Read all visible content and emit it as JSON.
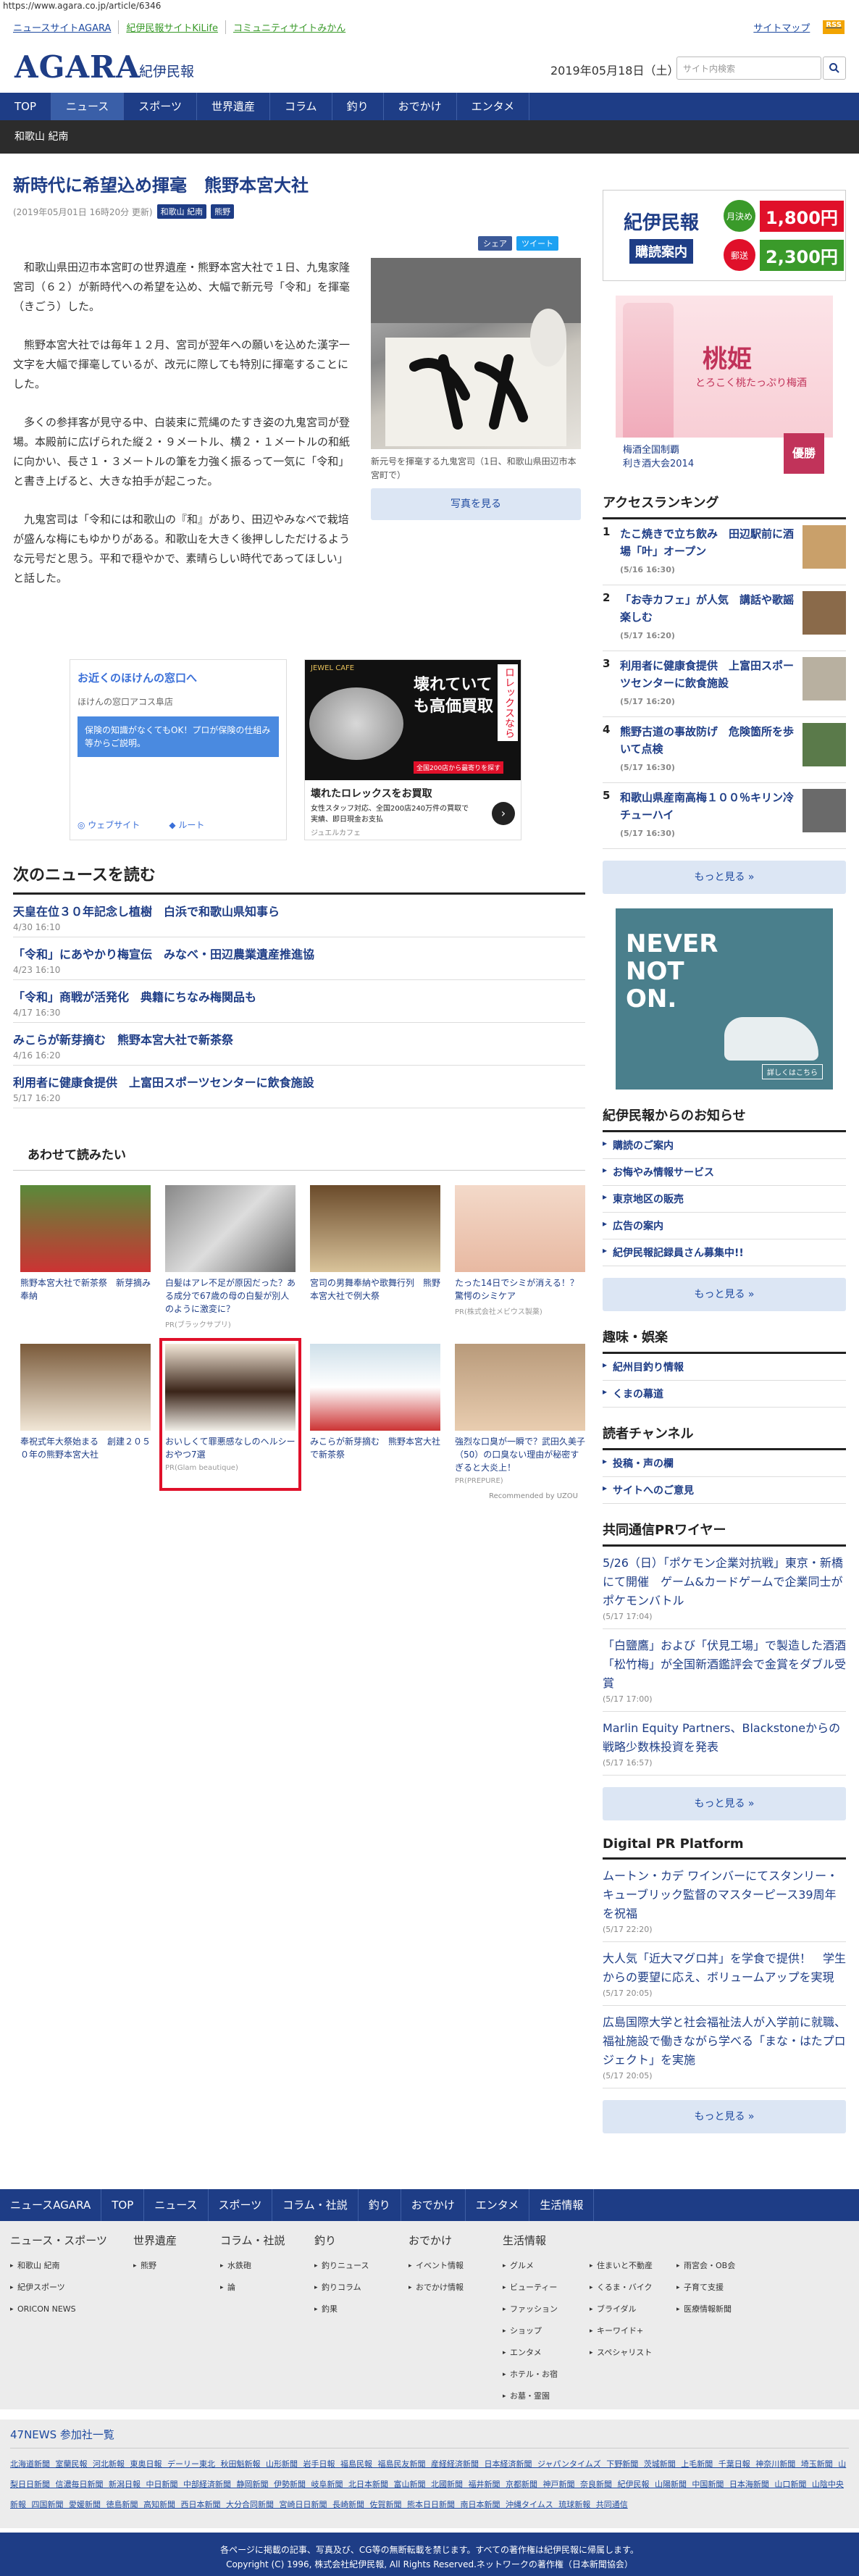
{
  "browser": {
    "url": "https://www.agara.co.jp/article/6346"
  },
  "header": {
    "links": [
      "ニュースサイトAGARA",
      "紀伊民報サイトKiLife",
      "コミュニティサイトみかん"
    ],
    "right_links": [
      "サイトマップ",
      "RSS"
    ],
    "logo": "AGARA",
    "logo_sub": "紀伊民報",
    "date": "2019年05月18日（土）",
    "search_placeholder": "サイト内検索"
  },
  "nav": [
    "TOP",
    "ニュース",
    "スポーツ",
    "世界遺産",
    "コラム",
    "釣り",
    "おでかけ",
    "エンタメ"
  ],
  "subnav": "和歌山 紀南",
  "article": {
    "title": "新時代に希望込め揮毫　熊野本宮大社",
    "date": "(2019年05月01日 16時20分 更新)",
    "tags": [
      "和歌山 紀南",
      "熊野"
    ],
    "share": [
      "シェア",
      "ツイート"
    ],
    "paragraphs": [
      "和歌山県田辺市本宮町の世界遺産・熊野本宮大社で１日、九鬼家隆宮司（６２）が新時代への希望を込め、大幅で新元号「令和」を揮毫（きごう）した。",
      "熊野本宮大社では毎年１２月、宮司が翌年への願いを込めた漢字一文字を大幅で揮毫しているが、改元に際しても特別に揮毫することにした。",
      "多くの参拝客が見守る中、白装束に荒縄のたすき姿の九鬼宮司が登場。本殿前に広げられた縦２・９メートル、横２・１メートルの和紙に向かい、長さ１・３メートルの筆を力強く振るって一気に「令和」と書き上げると、大きな拍手が起こった。",
      "九鬼宮司は「令和には和歌山の『和』があり、田辺やみなべで栽培が盛んな梅にもゆかりがある。和歌山を大きく後押ししただけるような元号だと思う。平和で穏やかで、素晴らしい時代であってほしい」と話した。"
    ],
    "photo_caption": "新元号を揮毫する九鬼宮司（1日、和歌山県田辺市本宮町で）",
    "photo_button": "写真を見る"
  },
  "ads": {
    "ad1_title": "お近くのほけんの窓口へ",
    "ad1_sub": "ほけんの窓口アコス阜店",
    "ad1_body": "保険の知識がなくてもOK！プロが保険の仕組み等からご説明。",
    "ad1_btn1": "ウェブサイト",
    "ad1_btn2": "ルート",
    "ad2_brand": "JEWEL CAFE",
    "ad2_big": "壊れていても高価買取",
    "ad2_side": "ロレックスなら",
    "ad2_strip": "全国200店から最寄りを探す",
    "ad2_title": "壊れたロレックスをお買取",
    "ad2_desc": "女性スタッフ対応、全国200店240万件の買取で実績、即日現金お支払",
    "ad2_sponsor": "ジュエルカフェ"
  },
  "next_news": {
    "heading": "次のニュースを読む",
    "items": [
      {
        "title": "天皇在位３０年記念し植樹　白浜で和歌山県知事ら",
        "date": "4/30 16:10"
      },
      {
        "title": "「令和」にあやかり梅宣伝　みなべ・田辺農業遺産推進協",
        "date": "4/23 16:10"
      },
      {
        "title": "「令和」商戦が活発化　典籍にちなみ梅関品も",
        "date": "4/17 16:30"
      },
      {
        "title": "みこらが新芽摘む　熊野本宮大社で新茶祭",
        "date": "4/16 16:20"
      },
      {
        "title": "利用者に健康食提供　上富田スポーツセンターに飲食施設",
        "date": "5/17 16:20"
      }
    ]
  },
  "recommend": {
    "heading": "あわせて読みたい",
    "cards": [
      {
        "title": "熊野本宮大社で新茶祭　新芽摘み奉納",
        "source": ""
      },
      {
        "title": "白髪はアレ不足が原因だった？ある成分で67歳の母の白髪が別人のように激変に？",
        "source": "PR(ブラックサプリ)"
      },
      {
        "title": "宮司の男舞奉納や歌舞行列　熊野本宮大社で例大祭",
        "source": ""
      },
      {
        "title": "たった14日でシミが消える！？驚愕のシミケア",
        "source": "PR(株式会社メビウス製薬)"
      },
      {
        "title": "奉祝式年大祭始まる　創建２０５０年の熊野本宮大社",
        "source": ""
      },
      {
        "title": "おいしくて罪悪感なしのヘルシーおやつ7選",
        "source": "PR(Glam beautique)"
      },
      {
        "title": "みこらが新芽摘む　熊野本宮大社で新茶祭",
        "source": ""
      },
      {
        "title": "強烈な口臭が一瞬で？武田久美子（50）の口臭ない理由が秘密すぎると大炎上！",
        "source": "PR(PREPURE)"
      }
    ],
    "powered": "Recommended by UZOU"
  },
  "sidebar": {
    "subscribe": {
      "logo": "紀伊民報",
      "read": "購読案内",
      "monthly_label": "月決め",
      "monthly_price": "1,800円",
      "mail_label": "郵送",
      "mail_price": "2,300円"
    },
    "momo": {
      "title": "桃姫",
      "sub": "とろこく桃たっぷり梅酒",
      "award": "梅酒全国制覇\n利き酒大会2014",
      "award_badge": "優勝"
    },
    "ranking_heading": "アクセスランキング",
    "ranking": [
      {
        "n": "1",
        "title": "たこ焼きで立ち飲み　田辺駅前に酒場「叶」オープン",
        "date": "(5/16 16:30)"
      },
      {
        "n": "2",
        "title": "「お寺カフェ」が人気　講話や歌謡楽しむ",
        "date": "(5/17 16:20)"
      },
      {
        "n": "3",
        "title": "利用者に健康食提供　上富田スポーツセンターに飲食施設",
        "date": "(5/17 16:20)"
      },
      {
        "n": "4",
        "title": "熊野古道の事故防げ　危険箇所を歩いて点検",
        "date": "(5/17 16:30)"
      },
      {
        "n": "5",
        "title": "和歌山県産南高梅１００％キリン冷チューハイ",
        "date": "(5/17 16:30)"
      }
    ],
    "more": "もっと見る »",
    "on_ad": {
      "text": "NEVER NOT ON.",
      "btn": "詳しくはこちら"
    },
    "notice_heading": "紀伊民報からのお知らせ",
    "notices": [
      "購読のご案内",
      "お悔やみ情報サービス",
      "東京地区の販売",
      "広告の案内",
      "紀伊民報記録員さん募集中!!"
    ],
    "hobby_heading": "趣味・娯楽",
    "hobbies": [
      "紀州目釣り情報",
      "くまの幕道"
    ],
    "reader_heading": "読者チャンネル",
    "readers": [
      "投稿・声の欄",
      "サイトへのご意見"
    ],
    "kyodo_heading": "共同通信PRワイヤー",
    "kyodo": [
      {
        "title": "5/26（日）「ポケモン企業対抗戦」東京・新橋にて開催　ゲーム&カードゲームで企業同士がポケモンバトル",
        "date": "(5/17 17:04)"
      },
      {
        "title": "「白鹽鷹」および「伏見工場」で製造した酒酒「松竹梅」が全国新酒鑑評会で金賞をダブル受賞",
        "date": "(5/17 17:00)"
      },
      {
        "title": "Marlin Equity Partners、Blackstoneからの戦略少数株投資を発表",
        "date": "(5/17 16:57)"
      }
    ],
    "dpr_heading": "Digital PR Platform",
    "dpr": [
      {
        "title": "ムートン・カデ ワインバーにてスタンリー・キューブリック監督のマスターピース39周年を祝福",
        "date": "(5/17 22:20)"
      },
      {
        "title": "大人気「近大マグロ丼」を学食で提供！　学生からの要望に応え、ボリュームアップを実現",
        "date": "(5/17 20:05)"
      },
      {
        "title": "広島国際大学と社会福祉法人が入学前に就職、福祉施設で働きながら学べる「まな・はたプロジェクト」を実施",
        "date": "(5/17 20:05)"
      }
    ]
  },
  "footer": {
    "nav": [
      "ニュースAGARA",
      "TOP",
      "ニュース",
      "スポーツ",
      "コラム・社説",
      "釣り",
      "おでかけ",
      "エンタメ",
      "生活情報"
    ],
    "cols": [
      {
        "h": "ニュース・スポーツ",
        "items": [
          "和歌山 紀南",
          "紀伊スポーツ",
          "ORICON NEWS"
        ]
      },
      {
        "h": "世界遺産",
        "items": [
          "熊野"
        ]
      },
      {
        "h": "コラム・社説",
        "items": [
          "水鉄砲",
          "論"
        ]
      },
      {
        "h": "釣り",
        "items": [
          "釣りニュース",
          "釣りコラム",
          "釣果"
        ]
      },
      {
        "h": "おでかけ",
        "items": [
          "イベント情報",
          "おでかけ情報"
        ]
      }
    ],
    "life_heading": "生活情報",
    "life_items": [
      "グルメ",
      "ビューティー",
      "ファッション",
      "ショップ",
      "エンタメ",
      "ホテル・お宿",
      "お墓・霊園",
      "住まいと不動産",
      "くるま・バイク",
      "ブライダル",
      "キーワイド+",
      "スペシャリスト",
      "雨宮会・OB会",
      "子育て支援",
      "医療情報新聞"
    ],
    "n47_heading": "47NEWS 参加社一覧",
    "n47_list": "北海道新聞 室蘭民報 河北新報 東奥日報 デーリー東北 秋田魁新報 山形新聞 岩手日報 福島民報 福島民友新聞 産経経済新聞 日本経済新聞 ジャパンタイムズ 下野新聞 茨城新聞 上毛新聞 千葉日報 神奈川新聞 埼玉新聞 山梨日日新聞 信濃毎日新聞 新潟日報 中日新聞 中部経済新聞 静岡新聞 伊勢新聞 岐阜新聞 北日本新聞 富山新聞 北國新聞 福井新聞 京都新聞 神戸新聞 奈良新聞 紀伊民報 山陽新聞 中国新聞 日本海新聞 山口新聞 山陰中央新報 四国新聞 愛媛新聞 徳島新聞 高知新聞 西日本新聞 大分合同新聞 宮崎日日新聞 長崎新聞 佐賀新聞 熊本日日新聞 南日本新聞 沖縄タイムス 琉球新報 共同通信",
    "copy1": "各ページに掲載の記事、写真及び、CG等の無断転載を禁じます。すべての著作権は紀伊民報に帰属します。",
    "copy2": "Copyright (C) 1996, 株式会社紀伊民報, All Rights Reserved.ネットワークの著作権（日本新聞協会）"
  }
}
